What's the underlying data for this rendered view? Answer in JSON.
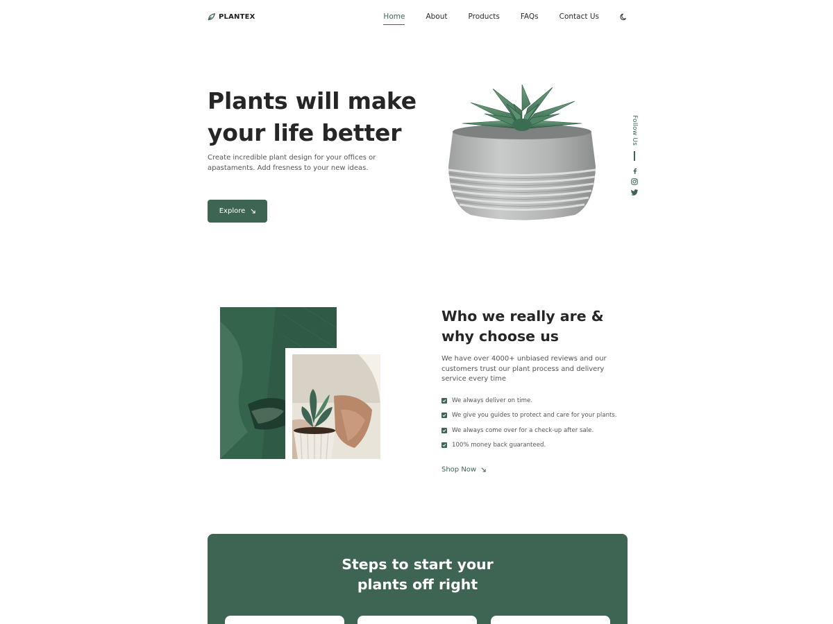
{
  "header": {
    "logo_text": "PLANTEX",
    "nav": [
      {
        "label": "Home",
        "active": true
      },
      {
        "label": "About",
        "active": false
      },
      {
        "label": "Products",
        "active": false
      },
      {
        "label": "FAQs",
        "active": false
      },
      {
        "label": "Contact Us",
        "active": false
      }
    ],
    "theme_icon": "moon-icon"
  },
  "hero": {
    "title_line1": "Plants will make",
    "title_line2": "your life better",
    "description": "Create incredible plant design for your offices or apastaments. Add fresness to your new ideas.",
    "explore_label": "Explore",
    "image": "succulent-in-concrete-pot",
    "follow_label": "Follow Us",
    "social_icons": [
      "facebook-icon",
      "instagram-icon",
      "twitter-icon"
    ]
  },
  "about": {
    "title_line1": "Who we really are &",
    "title_line2": "why choose us",
    "description": "We have over 4000+ unbiased reviews and our customers trust our plant process and delivery service every time",
    "checks": [
      "We always deliver on time.",
      "We give you guides to protect and care for your plants.",
      "We always come over for a check-up after sale.",
      "100% money back guaranteed."
    ],
    "shop_label": "Shop Now"
  },
  "steps": {
    "title_line1": "Steps to start your",
    "title_line2": "plants off right"
  },
  "colors": {
    "accent": "#3e6553",
    "text_dark": "#262626",
    "text_muted": "#555555",
    "background": "#ffffff"
  }
}
